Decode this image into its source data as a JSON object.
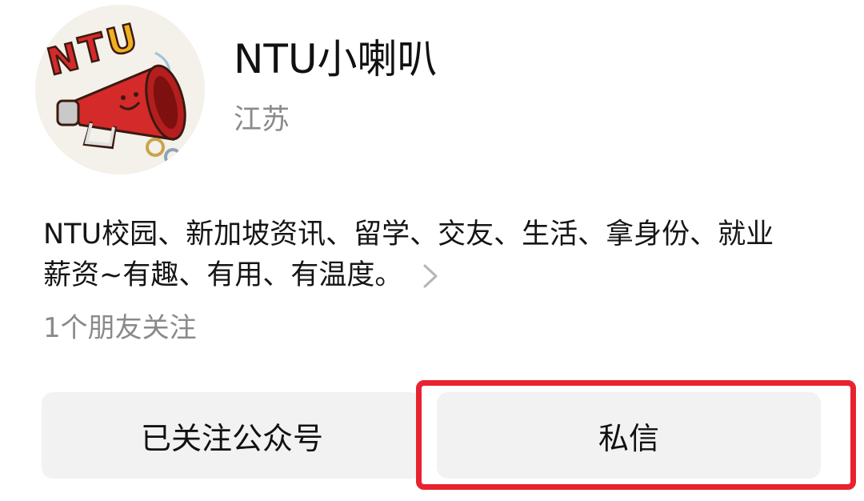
{
  "account": {
    "name": "NTU小喇叭",
    "location": "江苏",
    "avatar_text": "NTU",
    "avatar_icon": "megaphone-icon"
  },
  "description": {
    "line1": "NTU校园、新加坡资讯、留学、交友、生活、拿身份、就业",
    "line2": "薪资~有趣、有用、有温度。",
    "more_icon": "chevron-right-icon"
  },
  "followers_text": "1个朋友关注",
  "buttons": {
    "follow_label": "已关注公众号",
    "message_label": "私信"
  },
  "colors": {
    "highlight": "#e8232f",
    "button_bg": "#f2f2f2",
    "secondary_text": "#8a8a8a",
    "logo_red": "#d42a2a",
    "logo_gold": "#f0b020"
  }
}
